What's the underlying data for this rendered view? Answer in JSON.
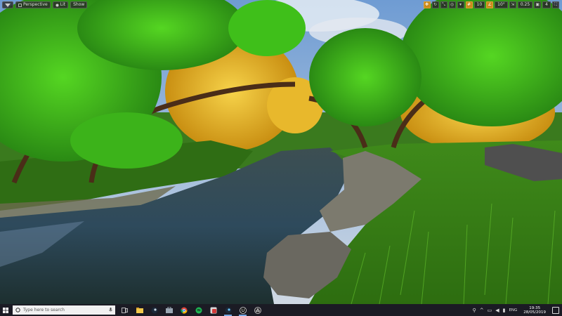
{
  "viewport": {
    "toolbar_left": {
      "perspective_label": "Perspective",
      "lit_label": "Lit",
      "show_label": "Show"
    },
    "toolbar_right": {
      "grid_snap_value": "10",
      "rotation_snap_value": "10°",
      "scale_snap_value": "0.25",
      "camera_speed_value": "4"
    }
  },
  "taskbar": {
    "search_placeholder": "Type here to search",
    "tray": {
      "language": "ENG",
      "time": "19:35",
      "date": "28/05/2019"
    },
    "apps": [
      "file-explorer",
      "steam",
      "store",
      "chrome",
      "spotify",
      "app-red",
      "steam-2",
      "unreal-engine",
      "obs"
    ]
  },
  "colors": {
    "taskbar_bg": "#1b1b24",
    "active_toggle": "#c98a1c",
    "taskbar_active_indicator": "#76a9e6"
  }
}
